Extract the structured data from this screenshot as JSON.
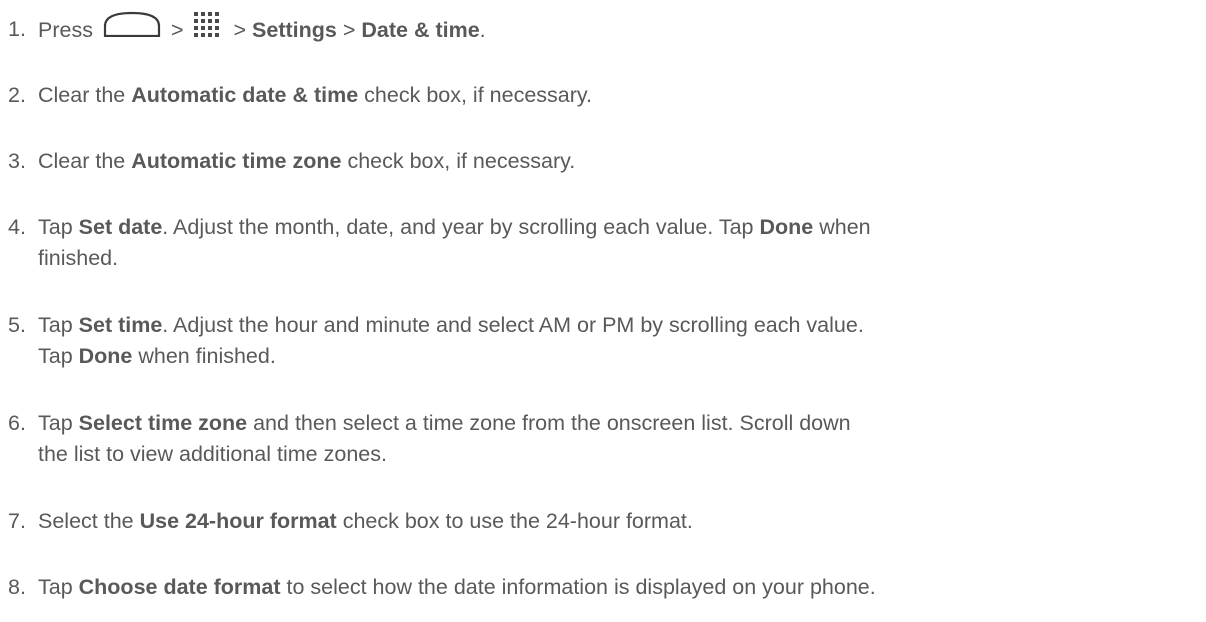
{
  "steps": [
    {
      "number": "1.",
      "press": "Press",
      "sep1": ">",
      "sep2": ">",
      "settings": "Settings",
      "sep3": ">",
      "date_time": "Date & time",
      "end": ".",
      "icons": [
        "home-icon",
        "apps-grid-icon"
      ]
    },
    {
      "number": "2.",
      "pre": "Clear the ",
      "bold": "Automatic date & time",
      "post": " check box, if necessary."
    },
    {
      "number": "3.",
      "pre": "Clear the ",
      "bold": "Automatic time zone",
      "post": " check box, if necessary."
    },
    {
      "number": "4.",
      "pre": "Tap ",
      "bold1": "Set date",
      "mid": ". Adjust the month, date, and year by scrolling each value. Tap ",
      "bold2": "Done",
      "post": " when",
      "line2": "finished."
    },
    {
      "number": "5.",
      "pre": "Tap ",
      "bold1": "Set time",
      "mid": ". Adjust the hour and minute and select AM or PM by scrolling each value.",
      "line2_pre": "Tap ",
      "bold2": "Done",
      "line2_post": " when finished."
    },
    {
      "number": "6.",
      "pre": "Tap ",
      "bold": "Select time zone",
      "post": " and then select a time zone from the onscreen list. Scroll down",
      "line2": "the list to view additional time zones."
    },
    {
      "number": "7.",
      "pre": "Select the ",
      "bold": "Use 24-hour format",
      "post": " check box to use the 24-hour format."
    },
    {
      "number": "8.",
      "pre": "Tap ",
      "bold": "Choose date format",
      "post": " to select how the date information is displayed on your phone."
    }
  ]
}
